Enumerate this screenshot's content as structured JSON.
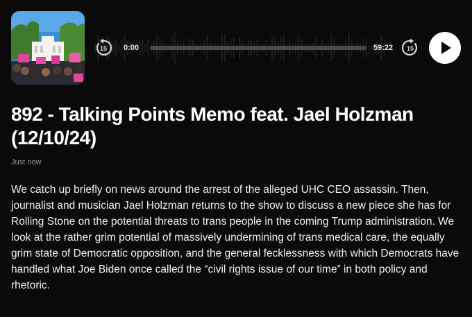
{
  "episode": {
    "title": "892 - Talking Points Memo feat. Jael Holzman (12/10/24)",
    "date": "Just now",
    "description": "We catch up briefly on news around the arrest of the alleged UHC CEO assassin. Then, journalist and musician Jael Holzman returns to the show to discuss a new piece she has for Rolling Stone on the potential threats to trans people in the coming Trump administration. We look at the rather grim potential of massively undermining of trans medical care, the equally grim state of Democratic opposition, and the general fecklessness with which Democrats have handled what Joe Biden once called the “civil rights issue of our time” in both policy and rhetoric."
  },
  "player": {
    "current_time": "0:00",
    "total_time": "59:22",
    "skip_back_label": "15",
    "skip_forward_label": "15",
    "progress": 0
  },
  "colors": {
    "background": "#0a0a0a",
    "progress_track": "#4a4a4a",
    "play_button": "#ffffff"
  }
}
